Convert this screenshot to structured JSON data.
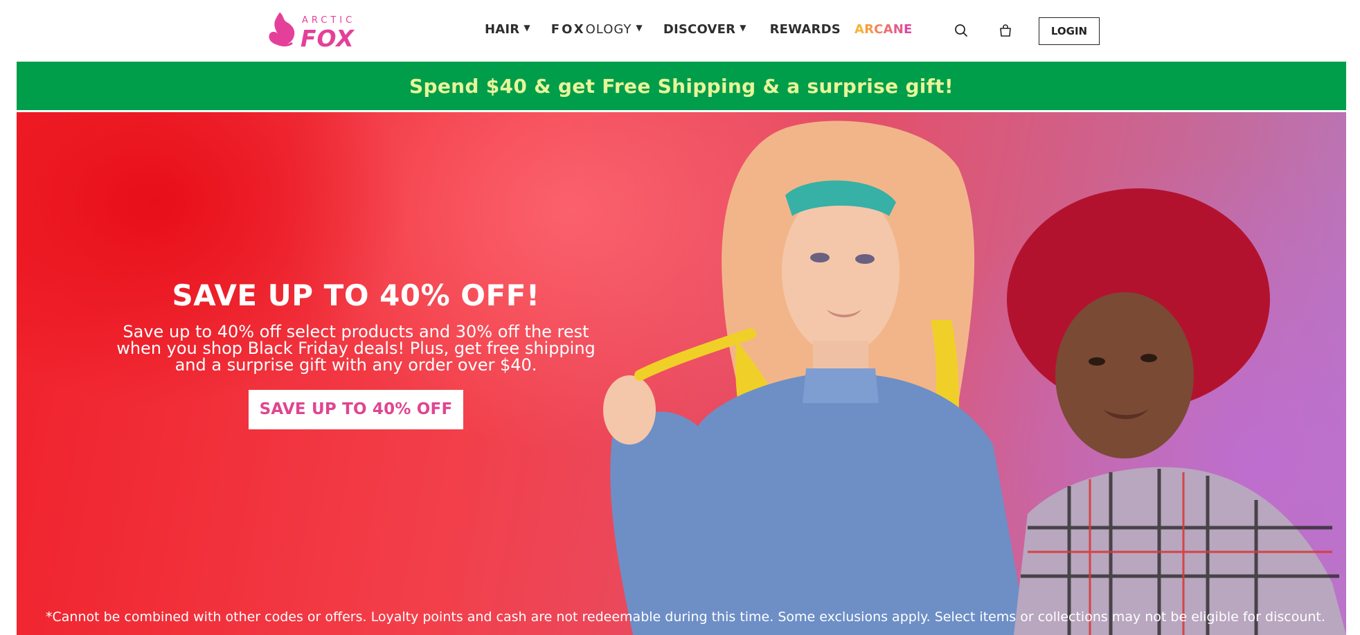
{
  "header": {
    "logo": {
      "top_text": "ARCTIC",
      "main_text": "FOX"
    },
    "nav": {
      "hair": "HAIR",
      "foxology_bold": "FOX",
      "foxology_light": "OLOGY",
      "discover": "DISCOVER",
      "rewards": "REWARDS",
      "arcane": [
        "A",
        "R",
        "C",
        "A",
        "N",
        "E"
      ]
    },
    "login_label": "LOGIN",
    "icons": {
      "search": "search-icon",
      "cart": "shopping-bag-icon",
      "caret": "caret-down-icon"
    }
  },
  "promo": {
    "text": "Spend $40 & get Free Shipping & a surprise gift!"
  },
  "hero": {
    "title": "SAVE UP TO 40% OFF!",
    "body": "Save up to 40% off select products and 30% off the rest when you shop Black Friday deals! Plus, get free shipping and a surprise gift with any order over $40.",
    "cta": "SAVE UP TO 40% OFF",
    "disclaimer": "*Cannot be combined with other codes or offers. Loyalty points and cash are not redeemable during this time. Some exclusions apply. Select items or collections may not be eligible for discount."
  },
  "colors": {
    "brand_pink": "#e4409a",
    "promo_green": "#009e4b",
    "promo_text": "#e9f59a",
    "cta_text": "#e0458f"
  }
}
